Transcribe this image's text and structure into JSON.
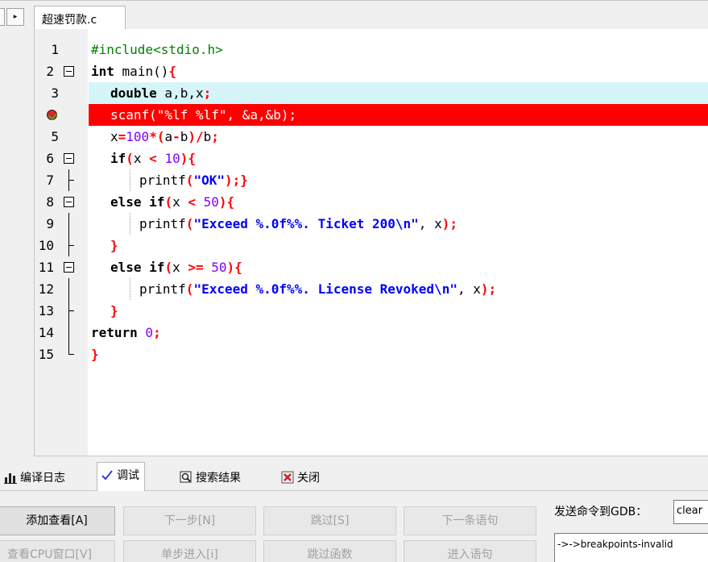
{
  "file_tab": {
    "label": "超速罚款.c"
  },
  "editor": {
    "lines": [
      {
        "num": "1"
      },
      {
        "num": "2"
      },
      {
        "num": "3"
      },
      {
        "num": ""
      },
      {
        "num": "5"
      },
      {
        "num": "6"
      },
      {
        "num": "7"
      },
      {
        "num": "8"
      },
      {
        "num": "9"
      },
      {
        "num": "10"
      },
      {
        "num": "11"
      },
      {
        "num": "12"
      },
      {
        "num": "13"
      },
      {
        "num": "14"
      },
      {
        "num": "15"
      }
    ],
    "code": {
      "l1": "#include<stdio.h>",
      "l2a": "int",
      "l2b": " main()",
      "l2c": "{",
      "l3a": "double",
      "l3b": " a,b,x",
      "l3c": ";",
      "l4": "scanf(\"%lf %lf\", &a,&b);",
      "l5a": "x",
      "l5b": "=",
      "l5c": "100",
      "l5d": "*(",
      "l5e": "a",
      "l5f": "-",
      "l5g": "b",
      "l5h": ")/",
      "l5i": "b",
      "l5j": ";",
      "l6a": "if",
      "l6b": "(",
      "l6c": "x ",
      "l6d": "<",
      "l6e": " 10",
      "l6f": "){",
      "l7a": "printf",
      "l7b": "(",
      "l7c": "\"OK\"",
      "l7d": ");}",
      "l8a": "else if",
      "l8b": "(",
      "l8c": "x ",
      "l8d": "<",
      "l8e": " 50",
      "l8f": "){",
      "l9a": "printf",
      "l9b": "(",
      "l9c": "\"Exceed %.0f%%. Ticket 200\\n\"",
      "l9d": ", x",
      "l9e": ");",
      "l10": "}",
      "l11a": "else if",
      "l11b": "(",
      "l11c": "x ",
      "l11d": ">=",
      "l11e": " 50",
      "l11f": "){",
      "l12a": "printf",
      "l12b": "(",
      "l12c": "\"Exceed %.0f%%. License Revoked\\n\"",
      "l12d": ", x",
      "l12e": ");",
      "l13": "}",
      "l14a": "return",
      "l14b": " 0",
      "l14c": ";",
      "l15": "}"
    }
  },
  "bottom_tabs": [
    {
      "label": "编译日志",
      "icon": "bar-chart-icon"
    },
    {
      "label": "调试",
      "icon": "checkmark-icon"
    },
    {
      "label": "搜索结果",
      "icon": "search-results-icon"
    },
    {
      "label": "关闭",
      "icon": "close-icon"
    }
  ],
  "debug": {
    "buttons": {
      "add_watch": "添加查看[A]",
      "next_step": "下一步[N]",
      "skip": "跳过[S]",
      "next_statement": "下一条语句",
      "cpu_window": "查看CPU窗口[V]",
      "step_into": "单步进入[i]",
      "skip_function": "跳过函数",
      "into_statement": "进入语句"
    },
    "gdb_label": "发送命令到GDB：",
    "gdb_input_value": "clear",
    "gdb_output": "->->breakpoints-invalid"
  },
  "colors": {
    "current_line": "#ff0000",
    "highlight_line": "#d5f5f9",
    "keyword": "#000000",
    "symbol": "#ff0000",
    "number": "#8000ff",
    "string": "#0000ff",
    "preprocessor": "#008000"
  }
}
